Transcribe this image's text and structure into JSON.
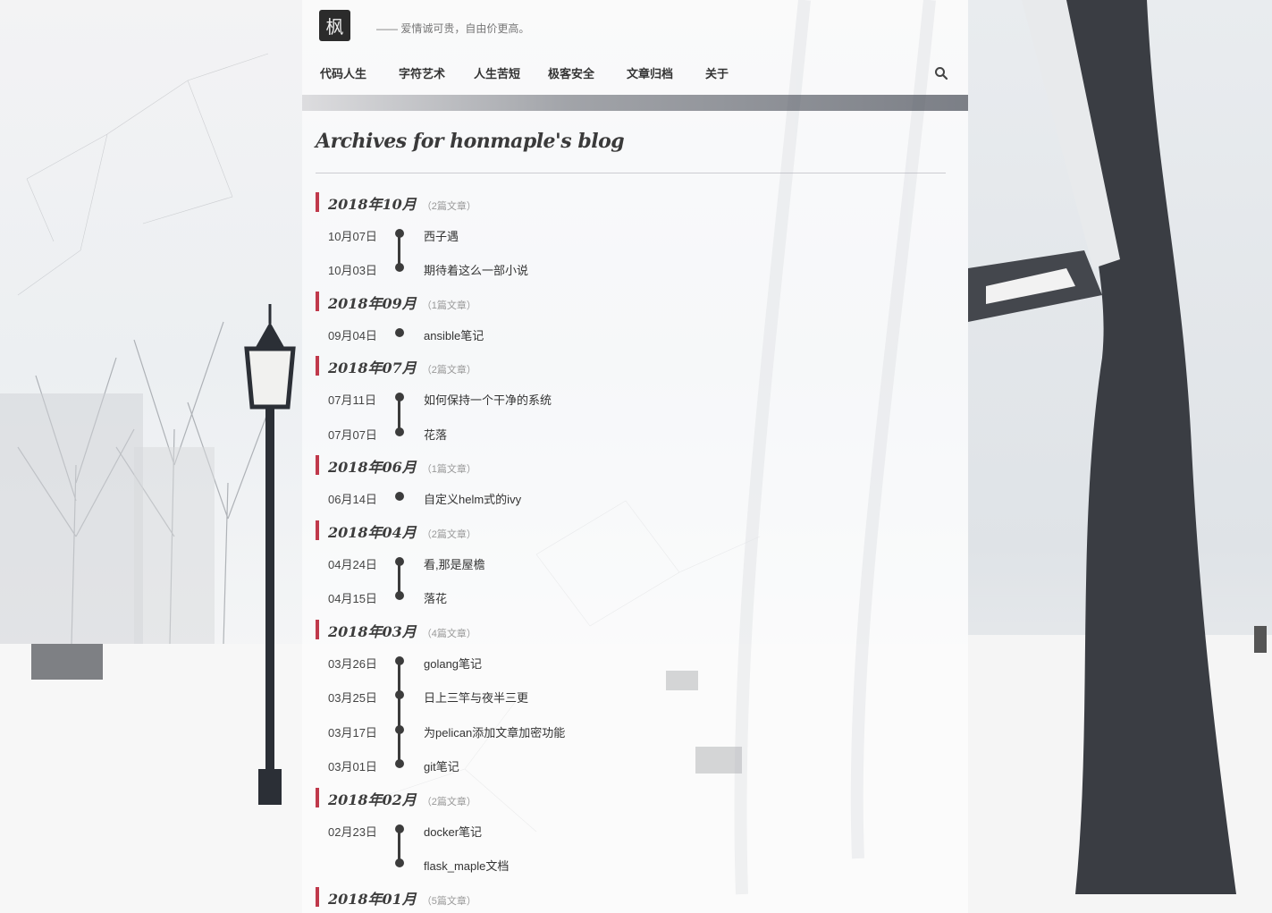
{
  "header": {
    "logo_glyph": "枫",
    "tagline": "—— 爱情诚可贵，自由价更高。"
  },
  "nav": {
    "items": [
      {
        "label": "代码人生"
      },
      {
        "label": "字符艺术"
      },
      {
        "label": "人生苦短"
      },
      {
        "label": "极客安全"
      },
      {
        "label": "文章归档"
      },
      {
        "label": "关于"
      }
    ],
    "search_icon": "search-icon"
  },
  "page": {
    "title": "Archives for honmaple's blog"
  },
  "archive": [
    {
      "month": "2018年10月",
      "count": "（2篇文章）",
      "posts": [
        {
          "date": "10月07日",
          "title": "西子遇"
        },
        {
          "date": "10月03日",
          "title": "期待着这么一部小说"
        }
      ]
    },
    {
      "month": "2018年09月",
      "count": "（1篇文章）",
      "posts": [
        {
          "date": "09月04日",
          "title": "ansible笔记"
        }
      ]
    },
    {
      "month": "2018年07月",
      "count": "（2篇文章）",
      "posts": [
        {
          "date": "07月11日",
          "title": "如何保持一个干净的系统"
        },
        {
          "date": "07月07日",
          "title": "花落"
        }
      ]
    },
    {
      "month": "2018年06月",
      "count": "（1篇文章）",
      "posts": [
        {
          "date": "06月14日",
          "title": "自定义helm式的ivy"
        }
      ]
    },
    {
      "month": "2018年04月",
      "count": "（2篇文章）",
      "posts": [
        {
          "date": "04月24日",
          "title": "看,那是屋檐"
        },
        {
          "date": "04月15日",
          "title": "落花"
        }
      ]
    },
    {
      "month": "2018年03月",
      "count": "（4篇文章）",
      "posts": [
        {
          "date": "03月26日",
          "title": "golang笔记"
        },
        {
          "date": "03月25日",
          "title": "日上三竿与夜半三更"
        },
        {
          "date": "03月17日",
          "title": "为pelican添加文章加密功能"
        },
        {
          "date": "03月01日",
          "title": "git笔记"
        }
      ]
    },
    {
      "month": "2018年02月",
      "count": "（2篇文章）",
      "posts": [
        {
          "date": "02月23日",
          "title": "docker笔记"
        },
        {
          "date": "",
          "title": "flask_maple文档"
        }
      ]
    },
    {
      "month": "2018年01月",
      "count": "（5篇文章）",
      "posts": []
    }
  ],
  "colors": {
    "accent": "#c0394b",
    "text": "#333333",
    "timeline": "#3c3c3c"
  }
}
